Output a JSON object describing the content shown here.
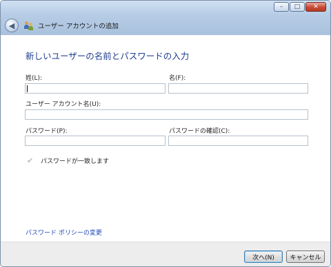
{
  "window": {
    "title": "ユーザー アカウントの追加",
    "minimize_glyph": "–",
    "maximize_glyph": "□",
    "close_glyph": "✕"
  },
  "nav": {
    "back_glyph": "◀",
    "icon": "users-icon"
  },
  "page": {
    "heading": "新しいユーザーの名前とパスワードの入力",
    "last_name_label": "姓(L):",
    "last_name_value": "",
    "first_name_label": "名(F):",
    "first_name_value": "",
    "account_name_label": "ユーザー アカウント名(U):",
    "account_name_value": "",
    "password_label": "パスワード(P):",
    "password_value": "",
    "confirm_label": "パスワードの確認(C):",
    "confirm_value": "",
    "match_status": "パスワードが一致します",
    "policy_link": "パスワード ポリシーの変更"
  },
  "footer": {
    "next_label": "次へ(N)",
    "cancel_label": "キャンセル"
  }
}
